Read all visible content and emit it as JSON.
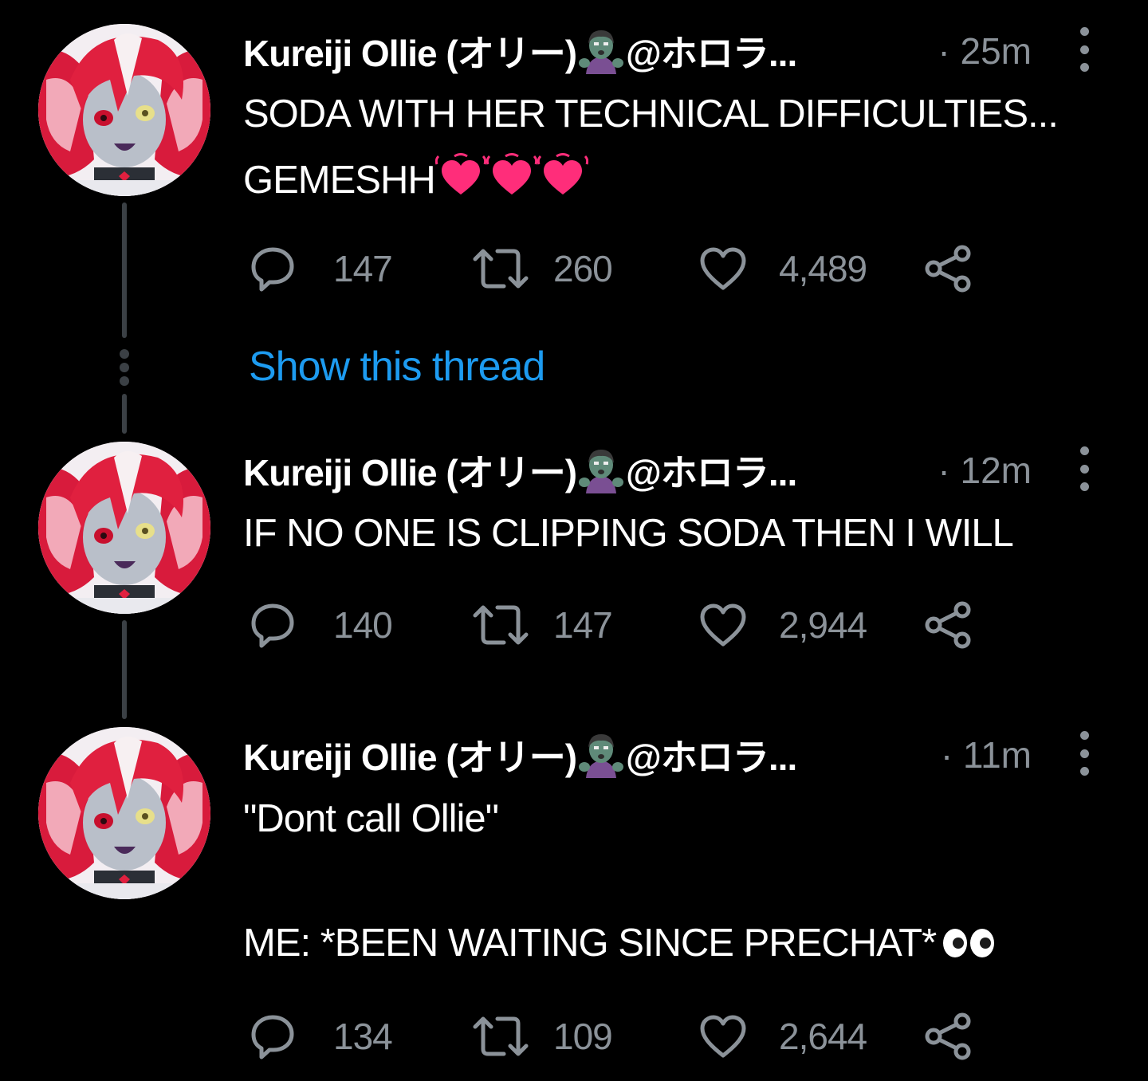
{
  "colors": {
    "background": "#000000",
    "link": "#1d9bf0",
    "muted": "#8b9299",
    "thread_line": "#3b4045"
  },
  "tweets": [
    {
      "name": "Kureiji Ollie (オリー)",
      "handle": "@ホロラ...",
      "time": "· 25m",
      "text_lines": [
        "SODA WITH HER TECHNICAL DIFFICULTIES...",
        "GEMESHH"
      ],
      "trailing_emoji": "beating-heart x3",
      "replies": "147",
      "retweets": "260",
      "likes": "4,489"
    },
    {
      "name": "Kureiji Ollie (オリー)",
      "handle": "@ホロラ...",
      "time": "· 12m",
      "text_lines": [
        "IF NO ONE IS CLIPPING SODA THEN I WILL"
      ],
      "replies": "140",
      "retweets": "147",
      "likes": "2,944"
    },
    {
      "name": "Kureiji Ollie (オリー)",
      "handle": "@ホロラ...",
      "time": "· 11m",
      "text_lines": [
        "\"Dont call Ollie\"",
        "ME: *BEEN WAITING SINCE PRECHAT*"
      ],
      "trailing_emoji": "eyes",
      "replies": "134",
      "retweets": "109",
      "likes": "2,644"
    }
  ],
  "show_thread": "Show this thread",
  "icons": {
    "avatar": "avatar-image",
    "name_emoji": "zombie-emoji",
    "reply": "reply-icon",
    "retweet": "retweet-icon",
    "like": "heart-icon",
    "share": "share-icon",
    "more": "more-vertical-icon"
  }
}
